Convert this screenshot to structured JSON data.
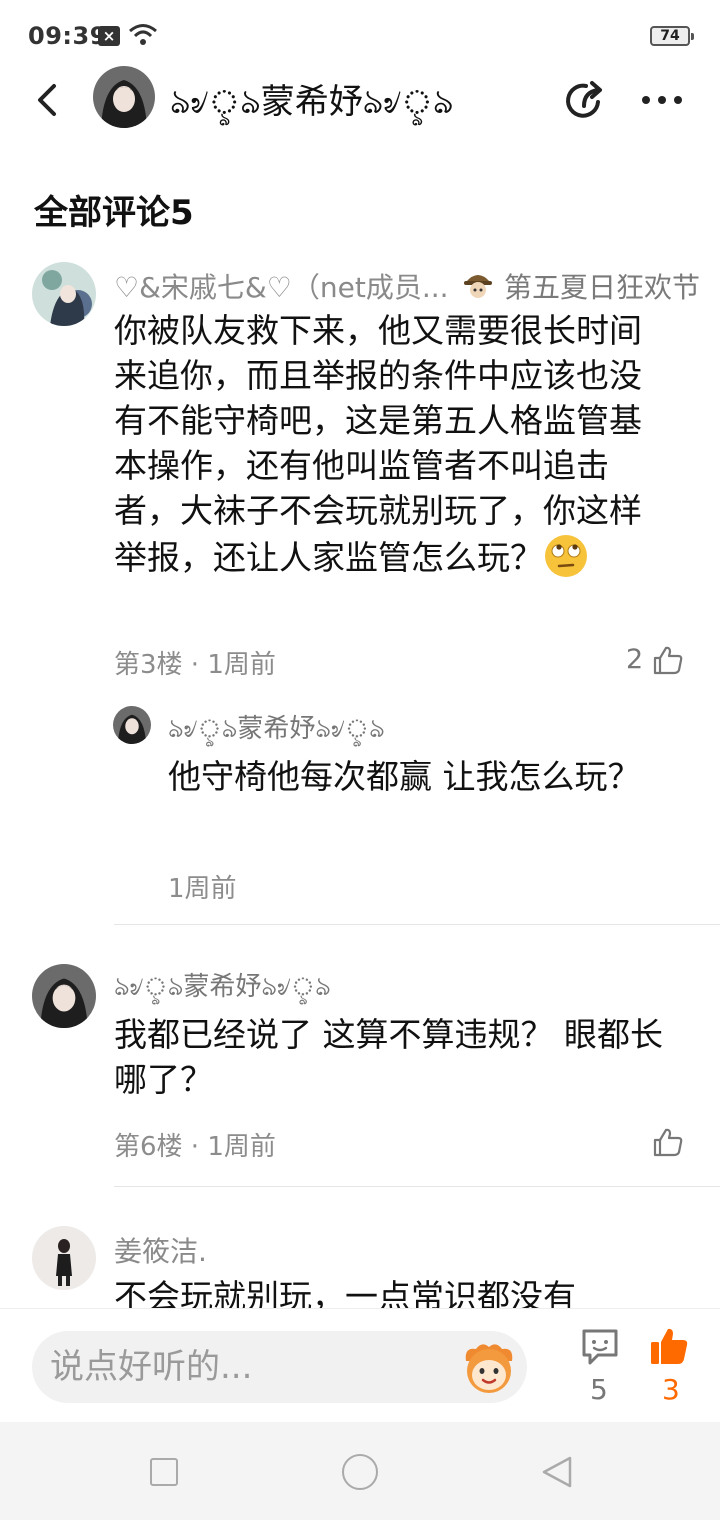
{
  "status_bar": {
    "time": "09:39",
    "battery": "74"
  },
  "header": {
    "name": "ঌ৶ৢঌ蒙希妤ঌ৶ৢঌ"
  },
  "section": {
    "title": "全部评论5"
  },
  "comments": [
    {
      "username": "♡&宋戚七&♡（net成员...",
      "badge": "第五夏日狂欢节",
      "text": "你被队友救下来，他又需要很长时间来追你，而且举报的条件中应该也没有不能守椅吧，这是第五人格监管基本操作，还有他叫监管者不叫追击者，大袜子不会玩就别玩了，你这样举报，还让人家监管怎么玩？",
      "meta": "第3楼 · 1周前",
      "likes": "2",
      "reply": {
        "username": "ঌ৶ৢঌ蒙希妤ঌ৶ৢঌ",
        "text": "他守椅他每次都赢 让我怎么玩？",
        "meta": "1周前"
      }
    },
    {
      "username": "ঌ৶ৢঌ蒙希妤ঌ৶ৢঌ",
      "text": "我都已经说了 这算不算违规？ 眼都长哪了？",
      "meta": "第6楼 · 1周前"
    },
    {
      "username": "姜筱洁.",
      "text": "不会玩就别玩，一点常识都没有"
    }
  ],
  "bottom_bar": {
    "placeholder": "说点好听的...",
    "comment_count": "5",
    "like_count": "3"
  },
  "colors": {
    "accent": "#ff6a00",
    "grey_text": "#8a8a8a"
  }
}
